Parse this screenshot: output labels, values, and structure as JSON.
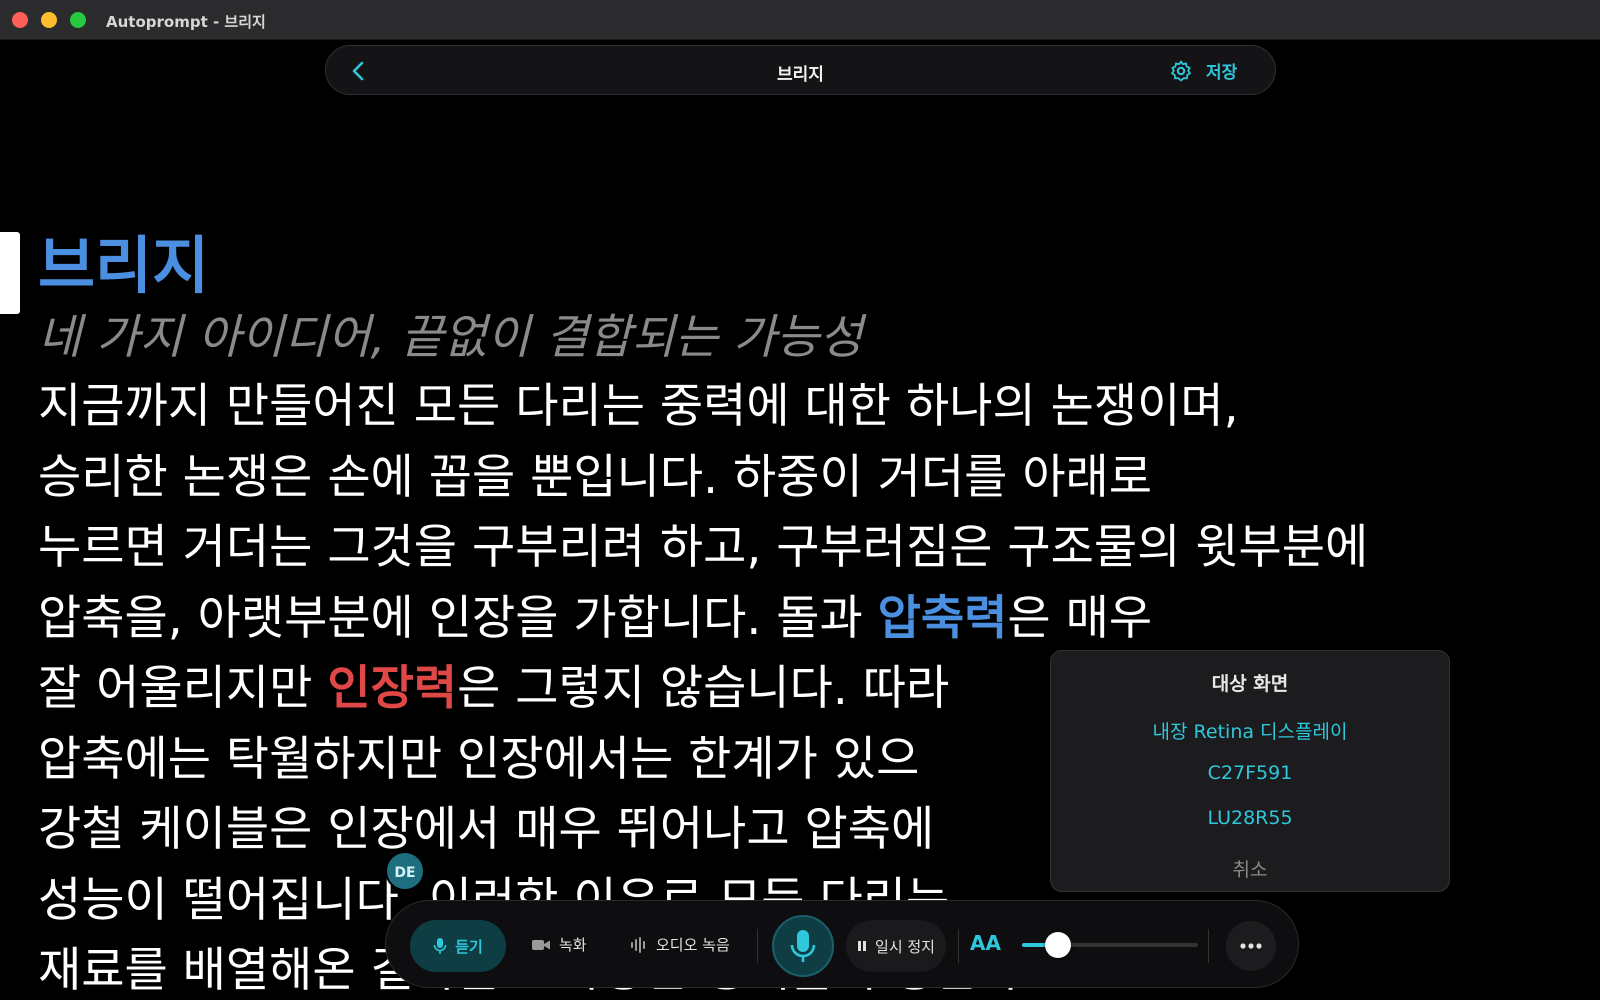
{
  "window": {
    "title": "Autoprompt - 브리지"
  },
  "topnav": {
    "title": "브리지",
    "save_label": "저장"
  },
  "script": {
    "title": "브리지",
    "subtitle": "네 가지 아이디어, 끝없이 결합되는 가능성",
    "lines": [
      {
        "parts": [
          {
            "text": "지금까지 만들어진 모든 다리는 중력에 대한 하나의 논쟁이며,"
          }
        ]
      },
      {
        "parts": [
          {
            "text": "승리한 논쟁은 손에 꼽을 뿐입니다. 하중이 거더를 아래로"
          }
        ]
      },
      {
        "parts": [
          {
            "text": "누르면 거더는 그것을 구부리려 하고, 구부러짐은 구조물의 윗부분에"
          }
        ]
      },
      {
        "parts": [
          {
            "text": "압축을, 아랫부분에 인장을 가합니다. 돌과 "
          },
          {
            "text": "압축력",
            "hl": "blue"
          },
          {
            "text": "은 매우"
          }
        ]
      },
      {
        "parts": [
          {
            "text": "잘 어울리지만 "
          },
          {
            "text": "인장력",
            "hl": "red"
          },
          {
            "text": "은 그렇지 않습니다. 따라"
          }
        ]
      },
      {
        "parts": [
          {
            "text": "압축에는 탁월하지만 인장에서는 한계가 있으"
          }
        ]
      },
      {
        "parts": [
          {
            "text": "강철 케이블은 인장에서 매우 뛰어나고 압축에"
          }
        ]
      },
      {
        "parts": [
          {
            "text": "성능이 떨어집니다. 이러한 이유로 모든 다리는"
          }
        ]
      },
      {
        "parts": [
          {
            "text": "재료를 배열해온 결과물로 다양한 형태를 구성한다"
          }
        ]
      }
    ]
  },
  "collaborator": {
    "initials": "DE"
  },
  "popover": {
    "title": "대상 화면",
    "options": [
      "내장 Retina 디스플레이",
      "C27F591",
      "LU28R55"
    ],
    "cancel": "취소"
  },
  "controls": {
    "listen": "듣기",
    "record": "녹화",
    "audio_record": "오디오 녹음",
    "pause": "일시 정지",
    "font_size": "AA",
    "font_size_level": 0.15
  },
  "colors": {
    "accent": "#2ec7dc",
    "highlight_blue": "#4b8fe0",
    "highlight_red": "#e04848"
  }
}
